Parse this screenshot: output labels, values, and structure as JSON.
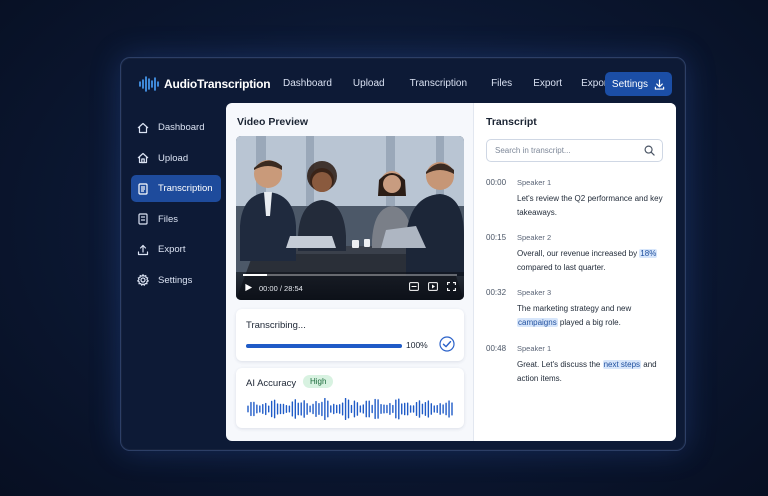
{
  "app": {
    "title": "AudioTranscription"
  },
  "nav": {
    "items": [
      "Dashboard",
      "Upload",
      "Transcription",
      "Files",
      "Export",
      "Export"
    ],
    "settings_label": "Settings"
  },
  "sidebar": {
    "items": [
      {
        "label": "Dashboard",
        "icon": "home-icon",
        "active": false
      },
      {
        "label": "Upload",
        "icon": "upload-home-icon",
        "active": false
      },
      {
        "label": "Transcription",
        "icon": "document-icon",
        "active": true
      },
      {
        "label": "Files",
        "icon": "files-icon",
        "active": false
      },
      {
        "label": "Export",
        "icon": "export-icon",
        "active": false
      },
      {
        "label": "Settings",
        "icon": "gear-icon",
        "active": false
      }
    ]
  },
  "video": {
    "title": "Video Preview",
    "time": "00:00 / 28:54",
    "progress": 0.11
  },
  "transcribing": {
    "label": "Transcribing...",
    "progress": 1.0,
    "percent_label": "100%"
  },
  "accuracy": {
    "label": "AI Accuracy",
    "badge": "High"
  },
  "transcript": {
    "title": "Transcript",
    "search_placeholder": "Search in transcript...",
    "entries": [
      {
        "time": "00:00",
        "speaker": "Speaker 1",
        "pre": "Let's review the Q2 performance and key takeaways.",
        "highlight": "",
        "post": ""
      },
      {
        "time": "00:15",
        "speaker": "Speaker 2",
        "pre": "Overall, our revenue increased by ",
        "highlight": "18%",
        "post": " compared to last quarter."
      },
      {
        "time": "00:32",
        "speaker": "Speaker 3",
        "pre": "The marketing strategy and new ",
        "highlight": "campaigns",
        "post": " played a big role."
      },
      {
        "time": "00:48",
        "speaker": "Speaker 1",
        "pre": "Great. Let's discuss the ",
        "highlight": "next steps",
        "post": " and action items."
      }
    ]
  },
  "colors": {
    "accent": "#1f5bc7",
    "active_sidebar": "#1e4b9c",
    "badge_bg": "#d8f2e1",
    "highlight": "#d7e6fb"
  }
}
